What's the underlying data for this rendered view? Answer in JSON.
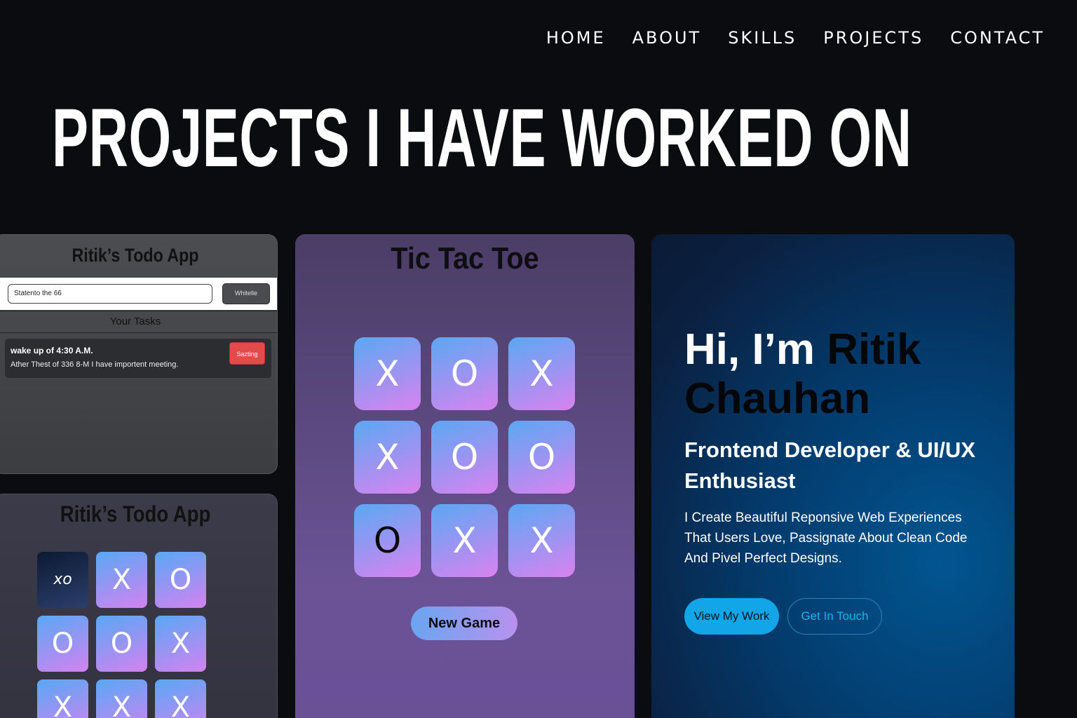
{
  "nav": {
    "items": [
      "HOME",
      "ABOUT",
      "SKILLS",
      "PROJECTS",
      "CONTACT"
    ]
  },
  "page_title": "PROJECTS I HAVE WORKED ON",
  "todo_card_1": {
    "title": "Ritik’s Todo App",
    "input_value": "Statento the 66",
    "add_button": "Whitelle",
    "tasks_heading": "Your Tasks",
    "task": {
      "name": "wake up of 4:30 A.M.",
      "description": "Ather Thest of 336 8-M  I have importent meeting.",
      "delete_button": "Sazting"
    }
  },
  "todo_card_2": {
    "title": "Ritik’s Todo App",
    "cells": [
      "xo",
      "X",
      "O",
      "O",
      "O",
      "X",
      "X",
      "X",
      "X"
    ]
  },
  "tic_tac_toe": {
    "title": "Tic Tac Toe",
    "cells": [
      "X",
      "O",
      "X",
      "X",
      "O",
      "O",
      "O",
      "X",
      "X"
    ],
    "new_game_button": "New Game"
  },
  "portfolio": {
    "greeting": "Hi, I’m",
    "name": "Ritik Chauhan",
    "role": "Frontend Developer & UI/UX Enthusiast",
    "description": "I Create Beautiful Reponsive Web Experiences That Users Love, Passignate About Clean Code And Pivel Perfect Designs.",
    "primary_button": "View My Work",
    "secondary_button": "Get In Touch"
  },
  "colors": {
    "background": "#0b0c10",
    "cell_gradient_start": "#5aa8f3",
    "cell_gradient_end": "#d982ef",
    "accent_blue": "#12a6e8"
  }
}
